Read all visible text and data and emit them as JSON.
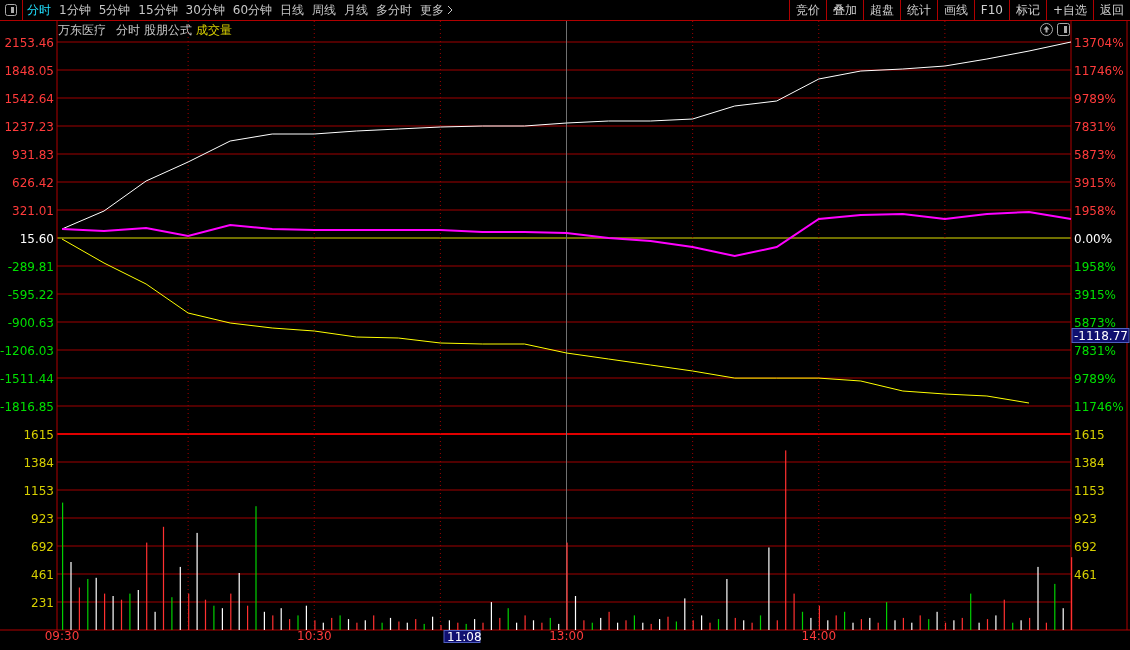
{
  "toolbar": {
    "tabs": [
      {
        "label": "分时",
        "selected": true
      },
      {
        "label": "1分钟",
        "selected": false
      },
      {
        "label": "5分钟",
        "selected": false
      },
      {
        "label": "15分钟",
        "selected": false
      },
      {
        "label": "30分钟",
        "selected": false
      },
      {
        "label": "60分钟",
        "selected": false
      },
      {
        "label": "日线",
        "selected": false
      },
      {
        "label": "周线",
        "selected": false
      },
      {
        "label": "月线",
        "selected": false
      },
      {
        "label": "多分时",
        "selected": false
      },
      {
        "label": "更多",
        "selected": false
      }
    ],
    "buttons": [
      "竞价",
      "叠加",
      "超盘",
      "统计",
      "画线",
      "F10",
      "标记",
      "+自选",
      "返回"
    ]
  },
  "info": {
    "stock": "万东医疗",
    "period": "分时",
    "formula": "股朋公式",
    "indicator": "成交量"
  },
  "price_panel": {
    "chart_data": {
      "type": "line",
      "ylim": [
        -1816.85,
        2153.46
      ],
      "yticks": [
        {
          "value": 2153.46,
          "label": "2153.46"
        },
        {
          "value": 1848.05,
          "label": "1848.05"
        },
        {
          "value": 1542.64,
          "label": "1542.64"
        },
        {
          "value": 1237.23,
          "label": "1237.23"
        },
        {
          "value": 931.83,
          "label": "931.83"
        },
        {
          "value": 626.42,
          "label": "626.42"
        },
        {
          "value": 321.01,
          "label": "321.01"
        },
        {
          "value": 15.6,
          "label": "15.60"
        },
        {
          "value": -289.81,
          "label": "-289.81"
        },
        {
          "value": -595.22,
          "label": "-595.22"
        },
        {
          "value": -900.63,
          "label": "-900.63"
        },
        {
          "value": -1206.03,
          "label": "-1206.03"
        },
        {
          "value": -1511.44,
          "label": "-1511.44"
        },
        {
          "value": -1816.85,
          "label": "-1816.85"
        }
      ],
      "series": [
        {
          "color": "#ffffff",
          "values": [
            114,
            310,
            637,
            845,
            1074,
            1150,
            1150,
            1183,
            1205,
            1226,
            1237,
            1237,
            1270,
            1292,
            1292,
            1314,
            1455,
            1510,
            1750,
            1837,
            1859,
            1892,
            1968,
            2055,
            2153
          ]
        },
        {
          "color": "#ff00ff",
          "values": [
            114,
            92,
            125,
            37,
            157,
            114,
            103,
            103,
            103,
            103,
            81,
            81,
            70,
            16,
            -17,
            -83,
            -181,
            -83,
            223,
            267,
            277,
            223,
            277,
            299,
            223
          ]
        },
        {
          "color": "#ffff00",
          "values": [
            5,
            -257,
            -486,
            -803,
            -912,
            -966,
            -999,
            -1064,
            -1075,
            -1130,
            -1141,
            -1141,
            -1239,
            -1304,
            -1370,
            -1435,
            -1512,
            -1512,
            -1512,
            -1544,
            -1653,
            -1686,
            -1708,
            -1784,
            null
          ]
        }
      ]
    }
  },
  "volume_panel": {
    "chart_data": {
      "type": "bar",
      "ylim": [
        0,
        1615
      ],
      "categories": [
        "09:30",
        null,
        null,
        null,
        null,
        null,
        null,
        null,
        null,
        null,
        null,
        null,
        null,
        null,
        null,
        null,
        null,
        null,
        null,
        null,
        null,
        null,
        null,
        null,
        null,
        null,
        null,
        null,
        null,
        null,
        "10:30",
        null,
        null,
        null,
        null,
        null,
        null,
        null,
        null,
        null,
        null,
        null,
        null,
        null,
        null,
        null,
        null,
        null,
        null,
        null,
        null,
        null,
        null,
        null,
        null,
        null,
        null,
        null,
        null,
        null,
        "13:00",
        null,
        null,
        null,
        null,
        null,
        null,
        null,
        null,
        null,
        null,
        null,
        null,
        null,
        null,
        null,
        null,
        null,
        null,
        null,
        null,
        null,
        null,
        null,
        null,
        null,
        null,
        null,
        null,
        null,
        "14:00",
        null,
        null,
        null,
        null,
        null,
        null,
        null,
        null,
        null,
        null,
        null,
        null,
        null,
        null,
        null,
        null,
        null,
        null,
        null,
        null,
        null,
        null,
        null,
        null,
        null,
        null,
        null,
        null,
        null,
        null
      ],
      "yticks": [
        {
          "value": 1615,
          "label": "1615"
        },
        {
          "value": 1384,
          "label": "1384"
        },
        {
          "value": 1153,
          "label": "1153"
        },
        {
          "value": 923,
          "label": "923"
        },
        {
          "value": 692,
          "label": "692"
        },
        {
          "value": 461,
          "label": "461"
        },
        {
          "value": 231,
          "label": "231"
        }
      ],
      "series": [
        {
          "color": "#ff3030",
          "values": [
            null,
            null,
            350,
            null,
            null,
            300,
            null,
            250,
            null,
            null,
            720,
            null,
            850,
            null,
            null,
            300,
            null,
            250,
            null,
            null,
            300,
            null,
            200,
            null,
            null,
            120,
            null,
            90,
            null,
            null,
            80,
            null,
            100,
            null,
            null,
            60,
            null,
            120,
            null,
            null,
            70,
            null,
            90,
            null,
            null,
            40,
            null,
            60,
            null,
            null,
            60,
            null,
            100,
            null,
            null,
            120,
            null,
            60,
            null,
            null,
            720,
            null,
            80,
            null,
            null,
            150,
            null,
            80,
            null,
            null,
            50,
            null,
            110,
            null,
            null,
            80,
            null,
            60,
            null,
            null,
            100,
            null,
            60,
            null,
            null,
            80,
            1480,
            300,
            null,
            null,
            200,
            null,
            120,
            null,
            null,
            90,
            null,
            60,
            null,
            null,
            100,
            null,
            120,
            null,
            null,
            60,
            null,
            100,
            null,
            null,
            90,
            null,
            250,
            null,
            null,
            100,
            null,
            60,
            null,
            null,
            600
          ]
        },
        {
          "color": "#ffffff",
          "values": [
            null,
            560,
            null,
            null,
            430,
            null,
            280,
            null,
            null,
            330,
            null,
            150,
            null,
            null,
            520,
            null,
            800,
            null,
            null,
            180,
            null,
            470,
            null,
            null,
            150,
            null,
            180,
            null,
            null,
            200,
            null,
            60,
            null,
            null,
            90,
            null,
            80,
            null,
            null,
            100,
            null,
            60,
            null,
            null,
            110,
            null,
            80,
            null,
            null,
            90,
            null,
            230,
            null,
            null,
            60,
            null,
            80,
            null,
            null,
            50,
            null,
            280,
            null,
            null,
            100,
            null,
            60,
            null,
            null,
            60,
            null,
            90,
            null,
            null,
            260,
            null,
            120,
            null,
            null,
            420,
            null,
            80,
            null,
            null,
            680,
            null,
            null,
            null,
            null,
            100,
            null,
            80,
            null,
            null,
            60,
            null,
            100,
            null,
            null,
            80,
            null,
            60,
            null,
            null,
            150,
            null,
            80,
            null,
            null,
            60,
            null,
            120,
            null,
            null,
            80,
            null,
            520,
            null,
            null,
            180,
            null
          ]
        },
        {
          "color": "#00d000",
          "values": [
            1050,
            null,
            null,
            420,
            null,
            null,
            null,
            null,
            300,
            null,
            null,
            null,
            null,
            270,
            null,
            null,
            null,
            null,
            200,
            null,
            null,
            null,
            null,
            1020,
            null,
            null,
            null,
            null,
            120,
            null,
            null,
            null,
            null,
            120,
            null,
            null,
            null,
            null,
            60,
            null,
            null,
            null,
            null,
            50,
            null,
            null,
            null,
            null,
            50,
            null,
            null,
            null,
            null,
            180,
            null,
            null,
            null,
            null,
            100,
            null,
            null,
            null,
            null,
            60,
            null,
            null,
            null,
            null,
            120,
            null,
            null,
            null,
            null,
            70,
            null,
            null,
            null,
            null,
            90,
            null,
            null,
            null,
            null,
            120,
            null,
            null,
            null,
            null,
            150,
            null,
            null,
            null,
            null,
            150,
            null,
            null,
            null,
            null,
            230,
            null,
            null,
            null,
            null,
            90,
            null,
            null,
            null,
            null,
            300,
            null,
            null,
            null,
            null,
            60,
            null,
            null,
            null,
            null,
            380,
            null,
            null
          ]
        }
      ]
    }
  },
  "right_axis": [
    {
      "text": "13704%",
      "kind": "up"
    },
    {
      "text": "11746%",
      "kind": "up"
    },
    {
      "text": "9789%",
      "kind": "up"
    },
    {
      "text": "7831%",
      "kind": "up"
    },
    {
      "text": "5873%",
      "kind": "up"
    },
    {
      "text": "3915%",
      "kind": "up"
    },
    {
      "text": "1958%",
      "kind": "up"
    },
    {
      "text": "0.00%",
      "kind": "flat"
    },
    {
      "text": "1958%",
      "kind": "down"
    },
    {
      "text": "3915%",
      "kind": "down"
    },
    {
      "text": "5873%",
      "kind": "down"
    },
    {
      "text": "7831%",
      "kind": "down"
    },
    {
      "text": "9789%",
      "kind": "down"
    },
    {
      "text": "11746%",
      "kind": "down"
    },
    {
      "text": "1615",
      "kind": "volume"
    },
    {
      "text": "1384",
      "kind": "volume"
    },
    {
      "text": "1153",
      "kind": "volume"
    },
    {
      "text": "923",
      "kind": "volume"
    },
    {
      "text": "692",
      "kind": "volume"
    },
    {
      "text": "461",
      "kind": "volume"
    }
  ],
  "cursor": {
    "time": "11:08",
    "value": "-1118.77"
  }
}
